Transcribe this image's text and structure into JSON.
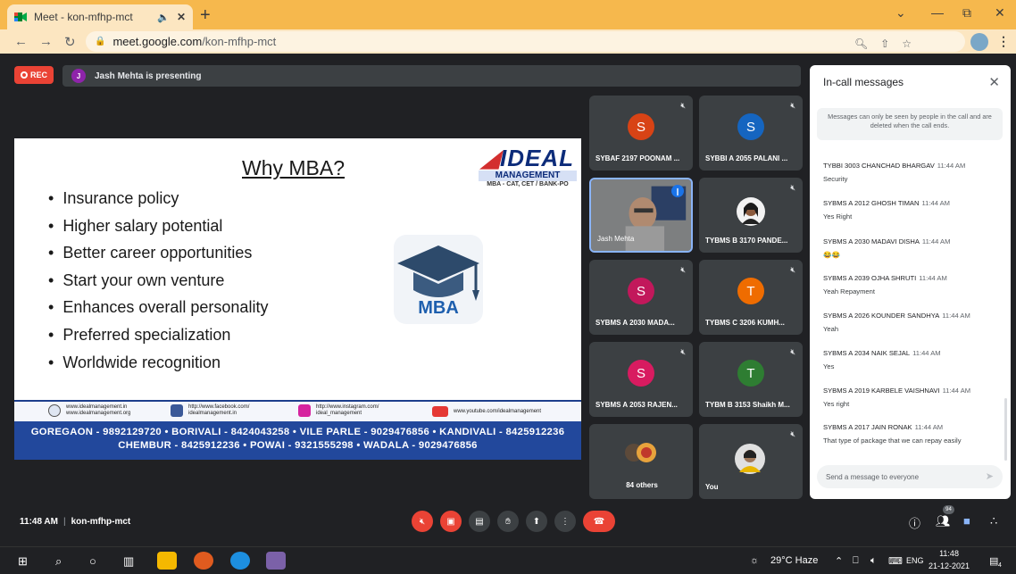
{
  "browser": {
    "tab_title": "Meet - kon-mfhp-mct",
    "tab_audio_icon": "speaker-icon",
    "new_tab_label": "+",
    "url_host": "meet.google.com",
    "url_path": "/kon-mfhp-mct",
    "win_minimize": "—",
    "win_restore": "⧉",
    "win_close": "✕",
    "win_dropdown": "⌄"
  },
  "meet": {
    "rec_label": "REC",
    "presenter_initial": "J",
    "presenter_text": "Jash Mehta is presenting",
    "meeting_time": "11:48 AM",
    "meeting_code": "kon-mfhp-mct",
    "participant_count_badge": "94"
  },
  "slide": {
    "title": "Why MBA?",
    "logo_brand": "IDEAL",
    "logo_sub": "MANAGEMENT",
    "logo_tag": "MBA - CAT, CET / BANK-PO",
    "bullets": [
      "Insurance policy",
      "Higher salary potential",
      "Better career opportunities",
      "Start your own venture",
      "Enhances overall personality",
      "Preferred specialization",
      "Worldwide recognition"
    ],
    "icon_label": "MBA",
    "links": {
      "web1": "www.idealmanagement.in",
      "web2": "www.idealmanagement.org",
      "fb1": "http://www.facebook.com/",
      "fb2": "idealmanagement.in",
      "ig1": "http://www.instagram.com/",
      "ig2": "ideal_management",
      "yt": "www.youtube.com/idealmanagement"
    },
    "branches_line1": "GOREGAON - 9892129720 • BORIVALI - 8424043258 • VILE PARLE - 9029476856 • KANDIVALI - 8425912236",
    "branches_line2": "CHEMBUR - 8425912236 • POWAI - 9321555298 • WADALA - 9029476856"
  },
  "tiles": [
    {
      "name": "SYBAF 2197 POONAM ...",
      "initial": "S",
      "color": "#d84315"
    },
    {
      "name": "SYBBI A 2055 PALANI ...",
      "initial": "S",
      "color": "#1565c0"
    },
    {
      "name": "Jash Mehta",
      "initial": "",
      "color": ""
    },
    {
      "name": "TYBMS B 3170 PANDE...",
      "initial": "",
      "color": ""
    },
    {
      "name": "SYBMS A 2030 MADA...",
      "initial": "S",
      "color": "#c2185b"
    },
    {
      "name": "TYBMS C 3206 KUMH...",
      "initial": "T",
      "color": "#ef6c00"
    },
    {
      "name": "SYBMS A 2053 RAJEN...",
      "initial": "S",
      "color": "#d81b60"
    },
    {
      "name": "TYBM B 3153 Shaikh M...",
      "initial": "T",
      "color": "#2e7d32"
    },
    {
      "name": "84 others",
      "initial": "",
      "color": ""
    },
    {
      "name": "You",
      "initial": "",
      "color": ""
    }
  ],
  "chat": {
    "title": "In-call messages",
    "note": "Messages can only be seen by people in the call and are deleted when the call ends.",
    "input_placeholder": "Send a message to everyone",
    "messages": [
      {
        "sender": "TYBBI 3003 CHANCHAD BHARGAV",
        "time": "11:44 AM",
        "text": "Security"
      },
      {
        "sender": "SYBMS A 2012 GHOSH TIMAN",
        "time": "11:44 AM",
        "text": "Yes Right"
      },
      {
        "sender": "SYBMS A 2030 MADAVI DISHA",
        "time": "11:44 AM",
        "text": "😂😂"
      },
      {
        "sender": "SYBMS A 2039 OJHA SHRUTI",
        "time": "11:44 AM",
        "text": "Yeah Repayment"
      },
      {
        "sender": "SYBMS A 2026 KOUNDER SANDHYA",
        "time": "11:44 AM",
        "text": "Yeah"
      },
      {
        "sender": "SYBMS A 2034 NAIK SEJAL",
        "time": "11:44 AM",
        "text": "Yes"
      },
      {
        "sender": "SYBMS A 2019 KARBELE VAISHNAVI",
        "time": "11:44 AM",
        "text": "Yes right"
      },
      {
        "sender": "SYBMS A 2017 JAIN RONAK",
        "time": "11:44 AM",
        "text": "That type of package that we can repay easily"
      }
    ]
  },
  "taskbar": {
    "weather": "29°C  Haze",
    "language": "ENG",
    "time": "11:48",
    "date": "21-12-2021",
    "notification_count": "4"
  }
}
